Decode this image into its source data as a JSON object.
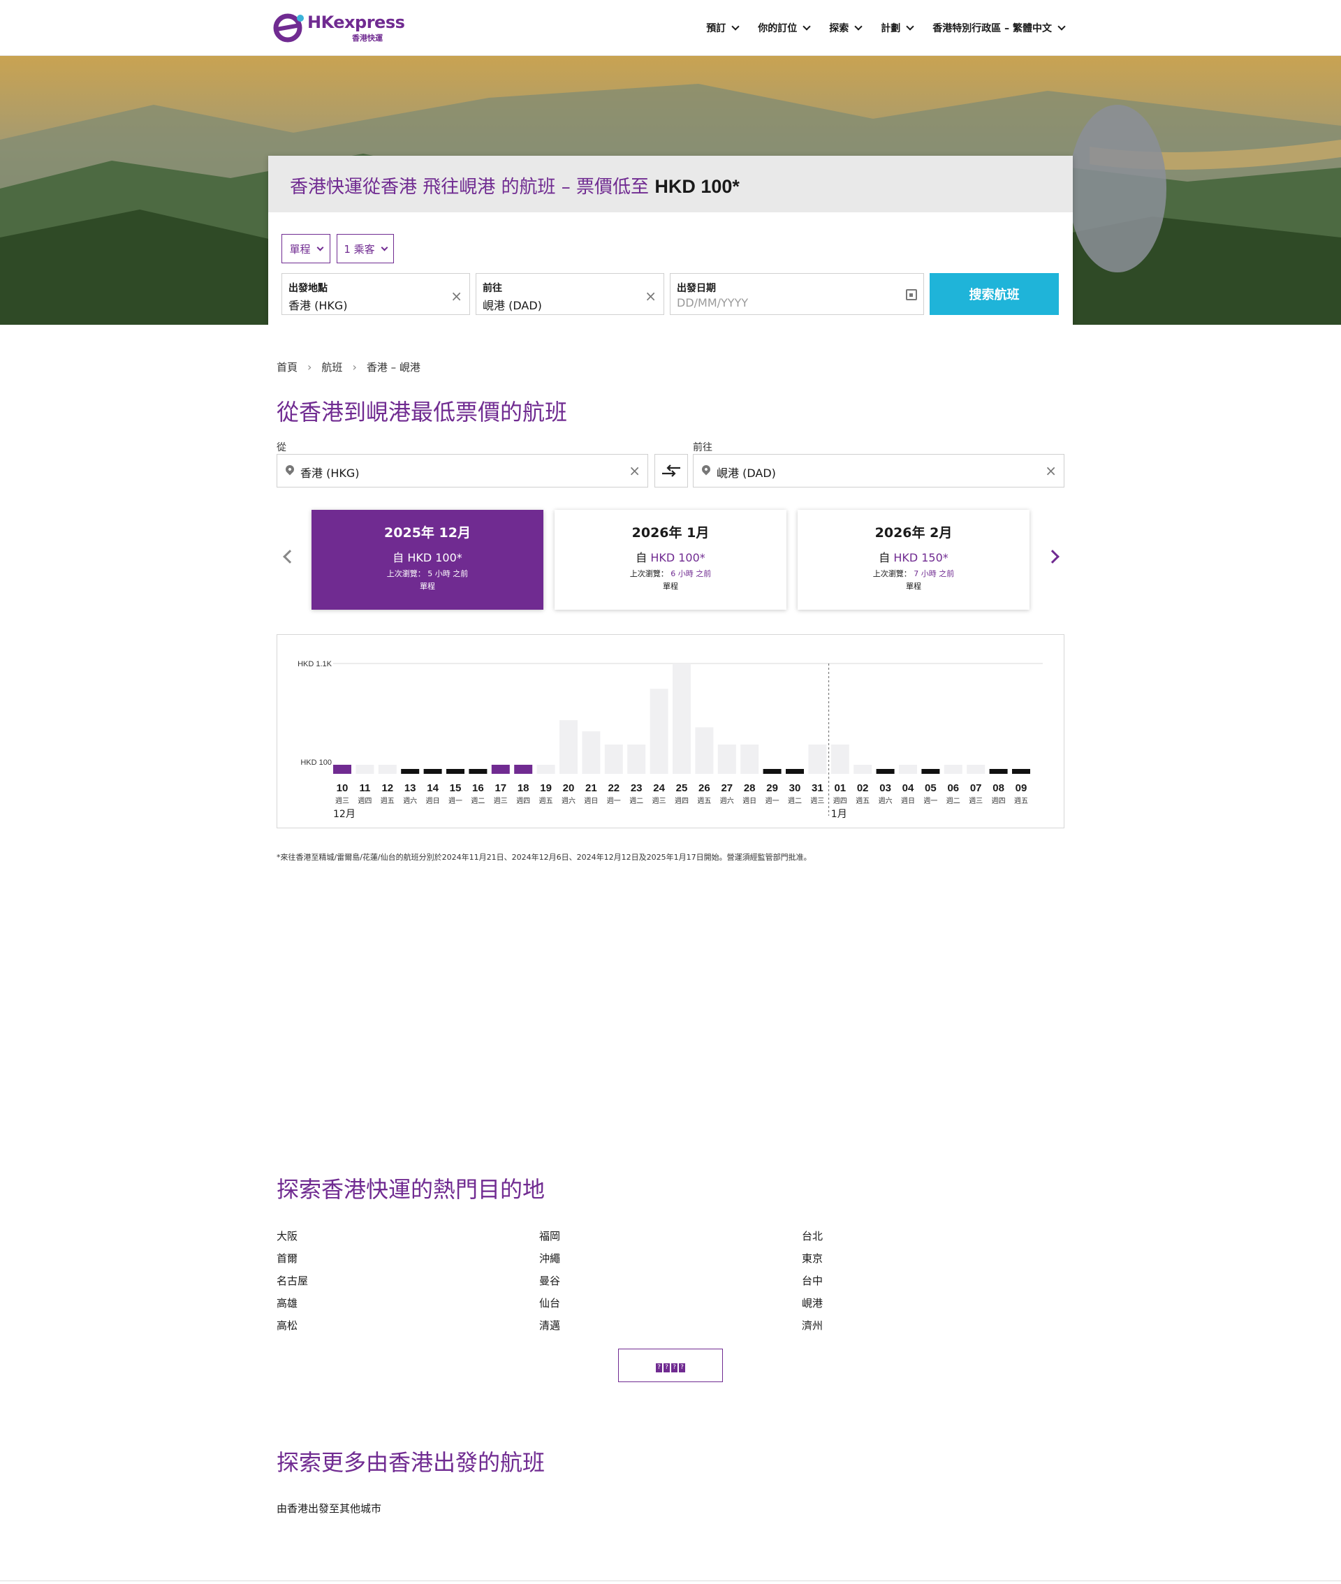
{
  "header": {
    "logo_text": "HKexpress",
    "logo_sub": "香港快運",
    "nav": [
      {
        "label": "預訂"
      },
      {
        "label": "你的訂位"
      },
      {
        "label": "探索"
      },
      {
        "label": "計劃"
      },
      {
        "label": "香港特別行政區 – 繁體中文"
      }
    ]
  },
  "hero": {
    "title": "香港快運從香港 飛往峴港 的航班 – 票價低至",
    "title_price": "HKD 100*",
    "trip_type": "單程",
    "passengers": "1 乘客",
    "origin": {
      "label": "出發地點",
      "value": "香港 (HKG)"
    },
    "destination": {
      "label": "前往",
      "value": "峴港 (DAD)"
    },
    "date": {
      "label": "出發日期",
      "placeholder": "DD/MM/YYYY"
    },
    "search_button": "搜索航班"
  },
  "breadcrumb": [
    "首頁",
    "航班",
    "香港 – 峴港"
  ],
  "main_title": "從香港到峴港最低票價的航班",
  "route": {
    "from_label": "從",
    "from_value": "香港 (HKG)",
    "to_label": "前往",
    "to_value": "峴港 (DAD)"
  },
  "months": [
    {
      "title": "2025年 12月",
      "price_prefix": "自",
      "price": "HKD 100*",
      "seen_prefix": "上次瀏覽：",
      "seen_value": "5 小時 之前",
      "type": "單程",
      "active": true
    },
    {
      "title": "2026年 1月",
      "price_prefix": "自",
      "price": "HKD 100*",
      "seen_prefix": "上次瀏覽：",
      "seen_value": "6 小時 之前",
      "type": "單程",
      "active": false
    },
    {
      "title": "2026年 2月",
      "price_prefix": "自",
      "price": "HKD 150*",
      "seen_prefix": "上次瀏覽：",
      "seen_value": "7 小時 之前",
      "type": "單程",
      "active": false
    }
  ],
  "colors": {
    "brand": "#702b91",
    "search_button": "#1fb4d9",
    "bar_unavailable": "#f0f0f2",
    "bar_low": "#111111"
  },
  "chart_data": {
    "type": "bar",
    "ylabel_ticks": [
      "HKD 1.1K",
      "HKD 100"
    ],
    "ylim": [
      100,
      1100
    ],
    "categories": [
      "10",
      "11",
      "12",
      "13",
      "14",
      "15",
      "16",
      "17",
      "18",
      "19",
      "20",
      "21",
      "22",
      "23",
      "24",
      "25",
      "26",
      "27",
      "28",
      "29",
      "30",
      "31",
      "01",
      "02",
      "03",
      "04",
      "05",
      "06",
      "07",
      "08",
      "09"
    ],
    "weekdays": [
      "週三",
      "週四",
      "週五",
      "週六",
      "週日",
      "週一",
      "週二",
      "週三",
      "週四",
      "週五",
      "週六",
      "週日",
      "週一",
      "週二",
      "週三",
      "週四",
      "週五",
      "週六",
      "週日",
      "週一",
      "週二",
      "週三",
      "週四",
      "週五",
      "週六",
      "週日",
      "週一",
      "週二",
      "週三",
      "週四",
      "週五"
    ],
    "values": [
      100,
      100,
      100,
      100,
      100,
      100,
      100,
      100,
      100,
      100,
      540,
      430,
      300,
      300,
      850,
      1100,
      470,
      300,
      300,
      100,
      100,
      300,
      300,
      100,
      100,
      100,
      100,
      100,
      100,
      100,
      100
    ],
    "states": [
      "selected",
      "none",
      "none",
      "low",
      "low",
      "low",
      "low",
      "selected",
      "selected",
      "none",
      "none",
      "none",
      "none",
      "none",
      "none",
      "none",
      "none",
      "none",
      "none",
      "low",
      "low",
      "none",
      "none",
      "none",
      "low",
      "none",
      "low",
      "none",
      "none",
      "low",
      "low"
    ],
    "month_labels": [
      {
        "index": 0,
        "label": "12月"
      },
      {
        "index": 22,
        "label": "1月"
      }
    ],
    "divider_after_index": 21
  },
  "footnote": "*來往香港至精城/雷爾島/花蓮/仙台的航班分別於2024年11月21日、2024年12月6日、2024年12月12日及2025年1月17日開始。營運須經監管部門批准。",
  "popular": {
    "title": "探索香港快運的熱門目的地",
    "columns": [
      [
        "大阪",
        "首爾",
        "名古屋",
        "高雄",
        "高松"
      ],
      [
        "福岡",
        "沖繩",
        "曼谷",
        "仙台",
        "清邁"
      ],
      [
        "台北",
        "東京",
        "台中",
        "峴港",
        "濟州"
      ]
    ],
    "more_button": "????"
  },
  "more_flights": {
    "title": "探索更多由香港出發的航班",
    "link": "由香港出發至其他城市"
  }
}
